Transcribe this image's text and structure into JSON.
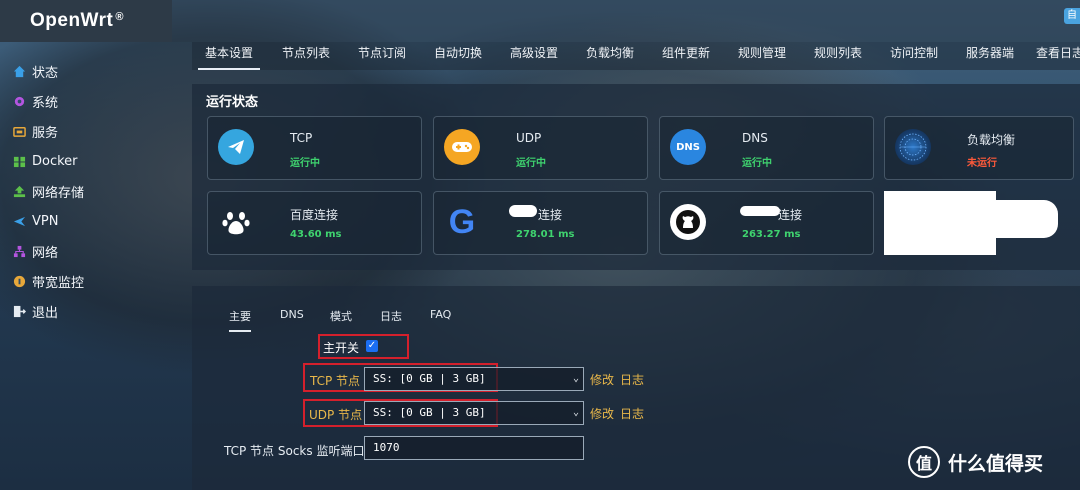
{
  "app": {
    "brand": "OpenWrt",
    "brand_mark": "®",
    "corner_badge": "自"
  },
  "sidebar": {
    "items": [
      {
        "label": "状态",
        "icon": "home-icon",
        "color": "#3aa0e8"
      },
      {
        "label": "系统",
        "icon": "gear-icon",
        "color": "#b455e0"
      },
      {
        "label": "服务",
        "icon": "services-icon",
        "color": "#e8a83a"
      },
      {
        "label": "Docker",
        "icon": "docker-icon",
        "color": "#5cc04a"
      },
      {
        "label": "网络存储",
        "icon": "storage-icon",
        "color": "#5cc04a"
      },
      {
        "label": "VPN",
        "icon": "vpn-icon",
        "color": "#3aa0e8"
      },
      {
        "label": "网络",
        "icon": "network-icon",
        "color": "#b455e0"
      },
      {
        "label": "带宽监控",
        "icon": "bandwidth-icon",
        "color": "#e8a83a"
      },
      {
        "label": "退出",
        "icon": "logout-icon",
        "color": "#e6ecf2"
      }
    ]
  },
  "tabs": [
    "基本设置",
    "节点列表",
    "节点订阅",
    "自动切换",
    "高级设置",
    "负载均衡",
    "组件更新",
    "规则管理",
    "规则列表",
    "访问控制",
    "服务器端",
    "查看日志"
  ],
  "status": {
    "title": "运行状态",
    "cards": [
      {
        "name": "TCP",
        "status": "运行中",
        "status_color": "#3fd36f",
        "icon": "telegram-icon"
      },
      {
        "name": "UDP",
        "status": "运行中",
        "status_color": "#3fd36f",
        "icon": "gamepad-icon"
      },
      {
        "name": "DNS",
        "status": "运行中",
        "status_color": "#3fd36f",
        "icon": "dns-icon",
        "icon_text": "DNS"
      },
      {
        "name": "负载均衡",
        "status": "未运行",
        "status_color": "#ff5a3a",
        "icon": "globe-icon"
      },
      {
        "name": "百度连接",
        "status": "43.60 ms",
        "status_color": "#3fd36f",
        "icon": "baidu-paw-icon"
      },
      {
        "name": "连接",
        "status": "278.01 ms",
        "status_color": "#3fd36f",
        "icon": "google-icon",
        "icon_text": "G"
      },
      {
        "name": "连接",
        "status": "263.27 ms",
        "status_color": "#3fd36f",
        "icon": "github-icon"
      }
    ]
  },
  "settings": {
    "tabs": [
      "主要",
      "DNS",
      "模式",
      "日志",
      "FAQ"
    ],
    "main_switch_label": "主开关",
    "main_switch_checked": true,
    "tcp_label": "TCP 节点",
    "tcp_value": "SS: [0 GB | 3 GB]",
    "udp_label": "UDP 节点",
    "udp_value": "SS: [0 GB | 3 GB]",
    "edit_label": "修改",
    "log_label": "日志",
    "socks_label": "TCP 节点 Socks 监听端口",
    "socks_value": "1070"
  },
  "watermark": {
    "text": "什么值得买",
    "glyph": "值"
  },
  "colors": {
    "accent_red": "#d4202c",
    "link_yellow": "#e9b84a",
    "status_green": "#3fd36f",
    "status_red": "#ff5a3a"
  }
}
